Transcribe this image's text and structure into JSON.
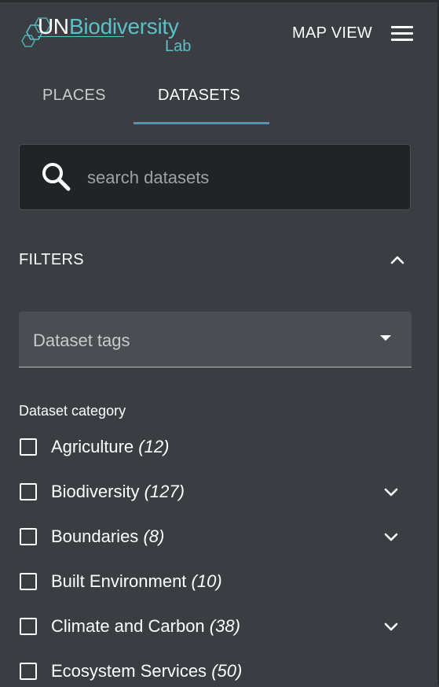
{
  "header": {
    "logo_un": "UN",
    "logo_bio": "Biodiversity",
    "logo_lab": "Lab",
    "map_view_label": "MAP VIEW",
    "menu_icon": "hamburger-menu-icon"
  },
  "tabs": [
    {
      "label": "PLACES",
      "active": false
    },
    {
      "label": "DATASETS",
      "active": true
    }
  ],
  "search": {
    "placeholder": "search datasets",
    "value": "",
    "icon": "search-icon"
  },
  "filters": {
    "title": "FILTERS",
    "collapse_icon": "chevron-up-icon",
    "tags_select": {
      "label": "Dataset tags",
      "icon": "caret-down-icon"
    },
    "category_title": "Dataset category",
    "categories": [
      {
        "name": "Agriculture",
        "count": "(12)",
        "expandable": false,
        "checked": false
      },
      {
        "name": "Biodiversity",
        "count": "(127)",
        "expandable": true,
        "checked": false
      },
      {
        "name": "Boundaries",
        "count": "(8)",
        "expandable": true,
        "checked": false
      },
      {
        "name": "Built Environment",
        "count": "(10)",
        "expandable": false,
        "checked": false
      },
      {
        "name": "Climate and Carbon",
        "count": "(38)",
        "expandable": true,
        "checked": false
      },
      {
        "name": "Ecosystem Services",
        "count": "(50)",
        "expandable": false,
        "checked": false
      }
    ]
  },
  "colors": {
    "panel_bg": "#3a3d41",
    "search_bg": "#212427",
    "accent": "#35a2ad",
    "logo_teal": "#5bc0c8",
    "select_bg": "#4a4e52"
  }
}
